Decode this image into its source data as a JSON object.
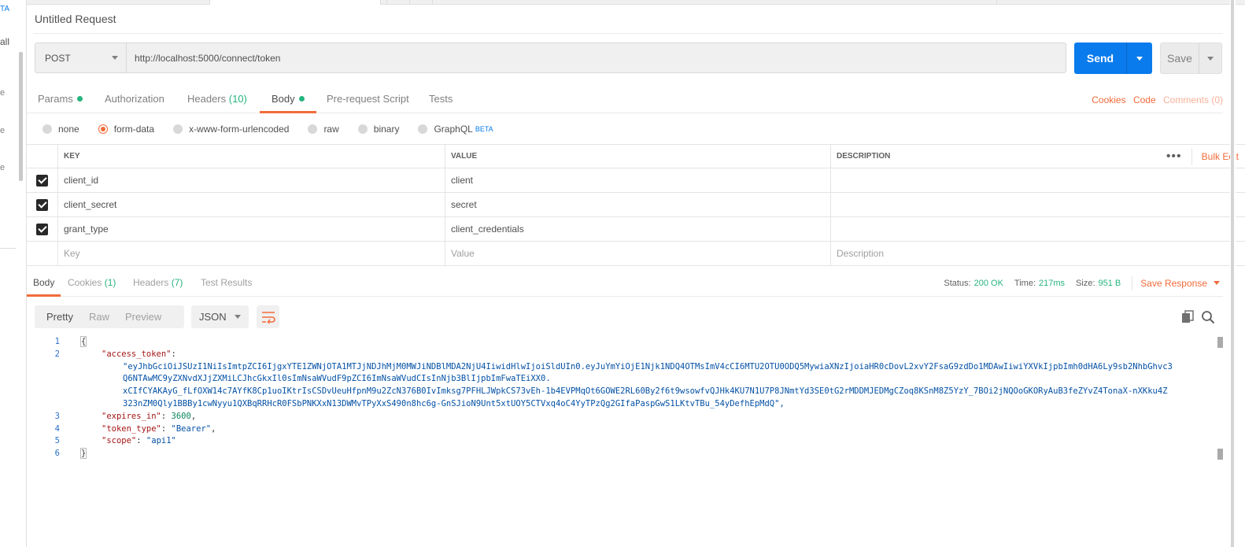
{
  "sidebar": {
    "beta_label": "TA",
    "all_label": "all",
    "fragments": [
      "e",
      "e",
      "e"
    ]
  },
  "request": {
    "title": "Untitled Request",
    "method": "POST",
    "url": "http://localhost:5000/connect/token",
    "send_label": "Send",
    "save_label": "Save"
  },
  "request_tabs": {
    "params": "Params",
    "authorization": "Authorization",
    "headers": "Headers",
    "headers_count": "(10)",
    "body": "Body",
    "prerequest": "Pre-request Script",
    "tests": "Tests",
    "cookies": "Cookies",
    "code": "Code",
    "comments": "Comments (0)"
  },
  "body_types": {
    "none": "none",
    "form_data": "form-data",
    "urlencoded": "x-www-form-urlencoded",
    "raw": "raw",
    "binary": "binary",
    "graphql": "GraphQL",
    "beta": "BETA",
    "selected": "form-data"
  },
  "kv_table": {
    "headers": {
      "key": "KEY",
      "value": "VALUE",
      "description": "DESCRIPTION",
      "bulk_edit": "Bulk Edit",
      "more": "•••"
    },
    "rows": [
      {
        "key": "client_id",
        "value": "client",
        "description": "",
        "checked": true
      },
      {
        "key": "client_secret",
        "value": "secret",
        "description": "",
        "checked": true
      },
      {
        "key": "grant_type",
        "value": "client_credentials",
        "description": "",
        "checked": true
      }
    ],
    "placeholders": {
      "key": "Key",
      "value": "Value",
      "description": "Description"
    }
  },
  "response_tabs": {
    "body": "Body",
    "cookies": "Cookies",
    "cookies_count": "(1)",
    "headers": "Headers",
    "headers_count": "(7)",
    "test_results": "Test Results"
  },
  "response_status": {
    "status_label": "Status:",
    "status_value": "200 OK",
    "time_label": "Time:",
    "time_value": "217ms",
    "size_label": "Size:",
    "size_value": "951 B",
    "save_response": "Save Response"
  },
  "response_view": {
    "pretty": "Pretty",
    "raw": "Raw",
    "preview": "Preview",
    "format": "JSON"
  },
  "response_json": {
    "line_numbers": [
      "1",
      "2",
      "3",
      "4",
      "5",
      "6"
    ],
    "open_brace": "{",
    "close_brace": "}",
    "access_token_key": "\"access_token\"",
    "access_token_lines": [
      "\"eyJhbGciOiJSUzI1NiIsImtpZCI6IjgxYTE1ZWNjOTA1MTJjNDJhMjM0MWJiNDBlMDA2NjU4IiwidHlwIjoiSldUIn0.eyJuYmYiOjE1Njk1NDQ4OTMsImV4cCI6MTU2OTU0ODQ5MywiaXNzIjoiaHR0cDovL2xvY2FsaG9zdDo1MDAwIiwiYXVkIjpbImh0dHA6Ly9sb2NhbGhvc3",
      "Q6NTAwMC9yZXNvdXJjZXMiLCJhcGkxIl0sImNsaWVudF9pZCI6ImNsaWVudCIsInNjb3BlIjpbImFwaTEiXX0.",
      "xCIfCYAKAyG_fLfOXW14c7AYfK8Cp1uoIKtrIsCSDvUeuHfpnM9u2ZcN376B0IvImksg7PFHLJWpkCS73vEh-1b4EVPMqOt6GOWE2RL60By2f6t9wsowfvQJHk4KU7N1U7P8JNmtYd3SE0tG2rMDDMJEDMgCZoq8KSnM8Z5YzY_7BOi2jNQOoGKORyAuB3feZYvZ4TonaX-nXKku4Z",
      "323nZM0Qly1BBBy1cwNyyu1QXBqRRHcR0FSbPNKXxN13DWMvTPyXxS490n8hc6g-GnSJioN9Unt5xtUOY5CTVxq4oC4YyTPzQg2GIfaPaspGwS1LKtvTBu_54yDefhEpMdQ\","
    ],
    "expires_in_key": "\"expires_in\"",
    "expires_in_value": "3600",
    "token_type_key": "\"token_type\"",
    "token_type_value": "\"Bearer\"",
    "scope_key": "\"scope\"",
    "scope_value": "\"api1\""
  },
  "colors": {
    "accent_orange": "#f26b3a",
    "send_blue": "#097bed",
    "status_green": "#26b47f"
  }
}
